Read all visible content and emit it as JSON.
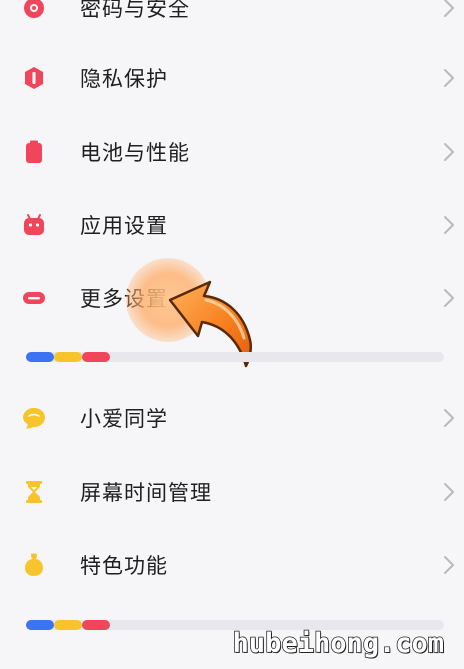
{
  "settings_items": [
    {
      "label": "密码与安全",
      "icon": "lock-icon",
      "color": "#f0455a"
    },
    {
      "label": "隐私保护",
      "icon": "privacy-shield-icon",
      "color": "#f0455a"
    },
    {
      "label": "电池与性能",
      "icon": "battery-icon",
      "color": "#f0455a"
    },
    {
      "label": "应用设置",
      "icon": "android-robot-icon",
      "color": "#f0455a"
    },
    {
      "label": "更多设置",
      "icon": "more-dots-icon",
      "color": "#f0455a"
    },
    {
      "label": "小爱同学",
      "icon": "chat-bubble-icon",
      "color": "#f7c52b"
    },
    {
      "label": "屏幕时间管理",
      "icon": "hourglass-icon",
      "color": "#f7c52b"
    },
    {
      "label": "特色功能",
      "icon": "bag-icon",
      "color": "#f7c52b"
    }
  ],
  "divider_colors": [
    "#3d73f2",
    "#f7c52b",
    "#f0455a"
  ],
  "watermark": "hubeihong.com"
}
